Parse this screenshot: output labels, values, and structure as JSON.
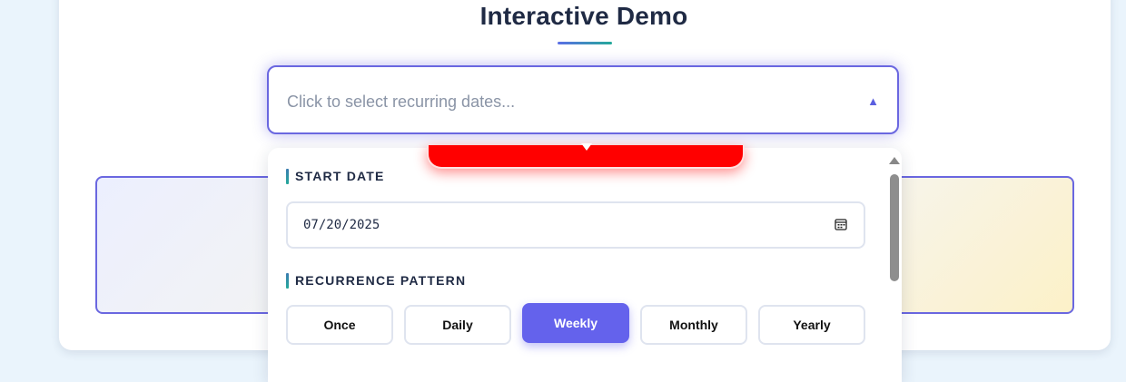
{
  "page": {
    "title": "Interactive Demo"
  },
  "picker": {
    "placeholder": "Click to select recurring dates...",
    "toggle_icon": "caret-up-icon"
  },
  "dropdown": {
    "start_date_label": "START DATE",
    "start_date_value": "07/20/2025",
    "recurrence_label": "RECURRENCE PATTERN",
    "patterns": [
      {
        "label": "Once",
        "selected": false
      },
      {
        "label": "Daily",
        "selected": false
      },
      {
        "label": "Weekly",
        "selected": true
      },
      {
        "label": "Monthly",
        "selected": false
      },
      {
        "label": "Yearly",
        "selected": false
      }
    ]
  },
  "colors": {
    "accent": "#6462ec",
    "tooltip": "#ff0000",
    "title": "#1f2a44"
  }
}
